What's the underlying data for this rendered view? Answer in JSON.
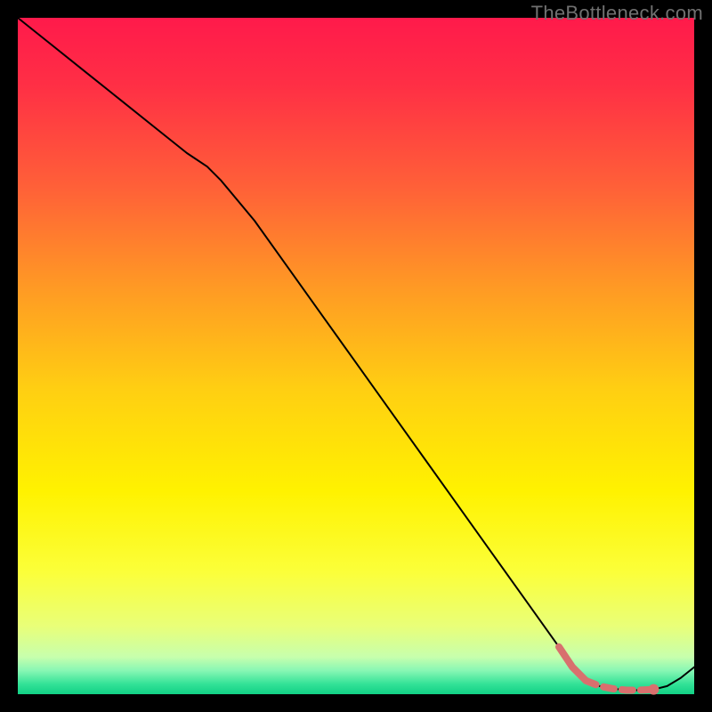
{
  "watermark": "TheBottleneck.com",
  "chart_data": {
    "type": "line",
    "title": "",
    "xlabel": "",
    "ylabel": "",
    "xlim": [
      0,
      100
    ],
    "ylim": [
      0,
      100
    ],
    "grid": false,
    "legend": false,
    "note": "Axes are unlabeled; values are normalized 0–100 estimated from pixel positions within the 760×760 plot area.",
    "series": [
      {
        "name": "main-curve",
        "color": "#000000",
        "stroke_width": 2,
        "x": [
          0,
          5,
          10,
          15,
          20,
          25,
          28,
          30,
          35,
          40,
          45,
          50,
          55,
          60,
          65,
          70,
          75,
          80,
          82,
          84,
          86,
          88,
          90,
          92,
          94,
          96,
          98,
          100
        ],
        "y": [
          100,
          96,
          92,
          88,
          84,
          80,
          78,
          76,
          70,
          63,
          56,
          49,
          42,
          35,
          28,
          21,
          14,
          7,
          4,
          2,
          1.2,
          0.8,
          0.6,
          0.6,
          0.7,
          1.2,
          2.4,
          4
        ]
      },
      {
        "name": "highlight-segment",
        "color": "#d8706e",
        "stroke_width": 8,
        "style": "solid-then-dashed",
        "x": [
          80,
          82,
          84,
          86,
          88,
          90,
          92,
          94
        ],
        "y": [
          7,
          4,
          2,
          1.2,
          0.8,
          0.6,
          0.6,
          0.7
        ]
      },
      {
        "name": "highlight-endpoint",
        "type": "scatter",
        "color": "#d8706e",
        "radius": 6,
        "x": [
          94
        ],
        "y": [
          0.7
        ]
      }
    ],
    "background_gradient": {
      "direction": "vertical",
      "stops": [
        {
          "offset": 0.0,
          "color": "#ff1a4b"
        },
        {
          "offset": 0.1,
          "color": "#ff2f45"
        },
        {
          "offset": 0.25,
          "color": "#ff6038"
        },
        {
          "offset": 0.4,
          "color": "#ff9a24"
        },
        {
          "offset": 0.55,
          "color": "#ffcf12"
        },
        {
          "offset": 0.7,
          "color": "#fff200"
        },
        {
          "offset": 0.82,
          "color": "#fbff3a"
        },
        {
          "offset": 0.9,
          "color": "#e9ff79"
        },
        {
          "offset": 0.945,
          "color": "#c7ffad"
        },
        {
          "offset": 0.965,
          "color": "#88f7b4"
        },
        {
          "offset": 0.985,
          "color": "#33e297"
        },
        {
          "offset": 1.0,
          "color": "#11d085"
        }
      ]
    }
  },
  "plot_geometry": {
    "outer_w": 800,
    "outer_h": 800,
    "inner_x": 20,
    "inner_y": 20,
    "inner_w": 760,
    "inner_h": 760
  }
}
